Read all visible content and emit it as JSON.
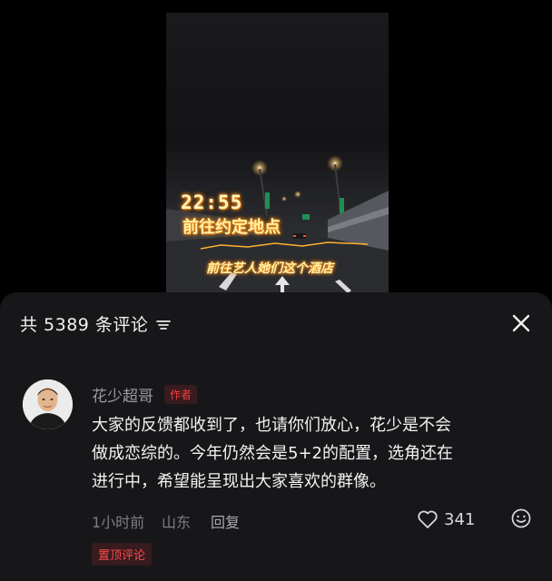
{
  "video": {
    "time_overlay": "22:55",
    "caption_primary": "前往约定地点",
    "caption_secondary": "前往艺人她们这个酒店"
  },
  "comments_panel": {
    "count_label": "共 5389 条评论",
    "filter_icon": "filter-lines-icon",
    "close_icon": "close-icon"
  },
  "comment": {
    "author_name": "花少超哥",
    "author_tag": "作者",
    "text_lines": [
      "大家的反馈都收到了，也请你们放心，花少是不会",
      "做成恋综的。今年仍然会是5+2的配置，选角还在",
      "进行中，希望能呈现出大家喜欢的群像。"
    ],
    "time": "1小时前",
    "location": "山东",
    "reply_label": "回复",
    "likes": "341",
    "pinned_label": "置顶评论"
  },
  "colors": {
    "sheet_background": "#17171a",
    "accent_red": "#ff3b3b",
    "caption_glow": "#ff7a00"
  }
}
